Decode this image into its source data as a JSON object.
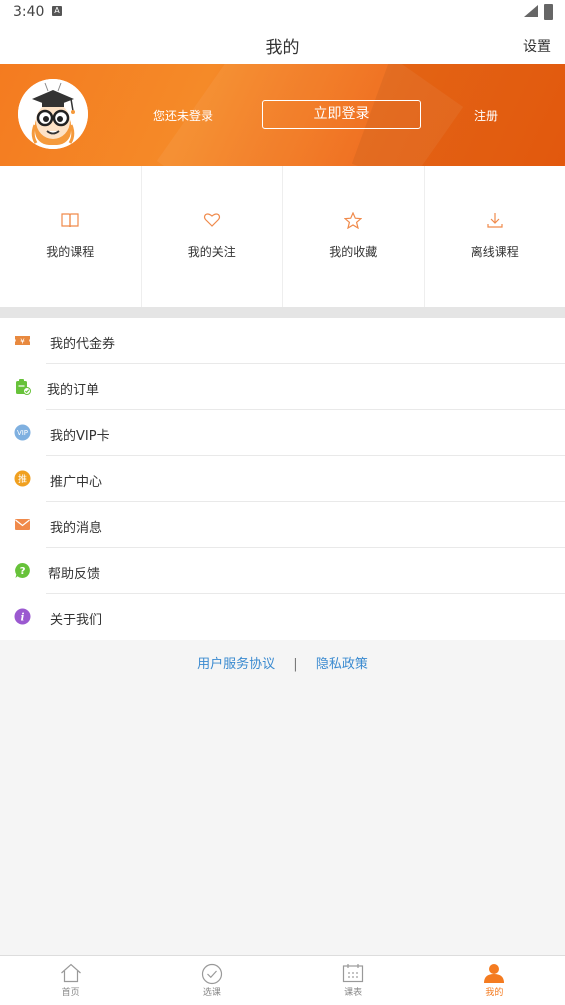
{
  "status_bar": {
    "time": "3:40",
    "notification_icon": "A"
  },
  "header": {
    "title": "我的",
    "settings_label": "设置"
  },
  "profile": {
    "guest_text": "您还未登录",
    "login_label": "立即登录",
    "register_label": "注册"
  },
  "quick_grid": [
    {
      "label": "我的课程",
      "icon": "book-icon"
    },
    {
      "label": "我的关注",
      "icon": "heart-icon"
    },
    {
      "label": "我的收藏",
      "icon": "star-icon"
    },
    {
      "label": "离线课程",
      "icon": "download-icon"
    }
  ],
  "menu": [
    {
      "label": "我的代金券",
      "icon": "voucher-icon",
      "color": "#e8893f"
    },
    {
      "label": "我的订单",
      "icon": "order-icon",
      "color": "#67c23a"
    },
    {
      "label": "我的VIP卡",
      "icon": "vip-icon",
      "color": "#7fb0e0"
    },
    {
      "label": "推广中心",
      "icon": "promotion-icon",
      "color": "#f0a020"
    },
    {
      "label": "我的消息",
      "icon": "mail-icon",
      "color": "#f08a4b"
    },
    {
      "label": "帮助反馈",
      "icon": "help-icon",
      "color": "#67c23a"
    },
    {
      "label": "关于我们",
      "icon": "info-icon",
      "color": "#9b59d0"
    }
  ],
  "footer_links": {
    "user_agreement": "用户服务协议",
    "divider": "|",
    "privacy_policy": "隐私政策"
  },
  "tab_bar": [
    {
      "label": "首页",
      "icon": "home-icon",
      "active": false
    },
    {
      "label": "选课",
      "icon": "check-circle-icon",
      "active": false
    },
    {
      "label": "课表",
      "icon": "calendar-icon",
      "active": false
    },
    {
      "label": "我的",
      "icon": "person-icon",
      "active": true
    }
  ],
  "colors": {
    "accent": "#f47b20",
    "link": "#3a8ad0"
  }
}
